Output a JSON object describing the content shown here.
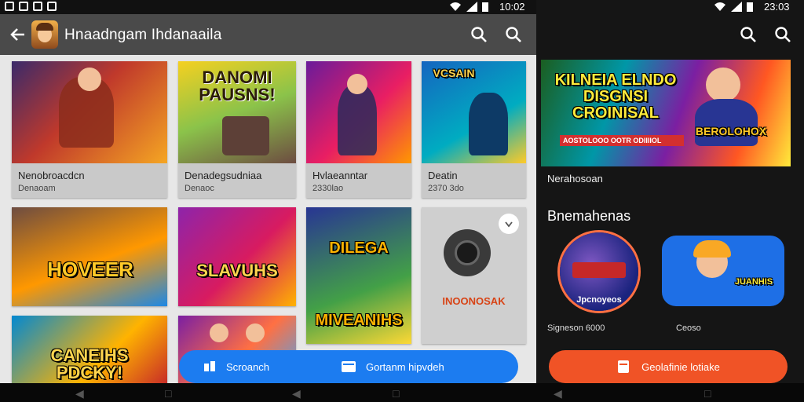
{
  "left": {
    "status_time": "10:02",
    "title": "Hnaadngam Ihdanaaila",
    "back_icon": "arrow-back-icon",
    "search_icons": [
      "search-icon",
      "search-icon"
    ],
    "cards": [
      {
        "title": "Nenobroacdcn",
        "subtitle": "Denaoam",
        "art": "",
        "colors": [
          "#3a2a6a",
          "#f5a623",
          "#c0392b"
        ]
      },
      {
        "title": "Denadegsudniaa",
        "subtitle": "Denaoc",
        "art": "DANOMI PAUSNS!",
        "colors": [
          "#f5d020",
          "#2e7d32",
          "#6d4c41"
        ]
      },
      {
        "title": "Hvlaeanntar",
        "subtitle": "2330lao",
        "art": "",
        "colors": [
          "#6a1b9a",
          "#e91e63",
          "#ff9800"
        ]
      },
      {
        "title": "Deatin",
        "subtitle": "2370 3do",
        "art": "VCSAIN",
        "colors": [
          "#1565c0",
          "#00acc1",
          "#ffca28"
        ]
      },
      {
        "title": "",
        "subtitle": "",
        "art": "HOVEER",
        "colors": [
          "#6d4c41",
          "#ff9800",
          "#1e88e5"
        ]
      },
      {
        "title": "",
        "subtitle": "",
        "art": "SLAVUHS",
        "colors": [
          "#8e24aa",
          "#ffb300",
          "#d81b60"
        ]
      },
      {
        "title": "",
        "subtitle": "",
        "art": "DILEGA MIVEANIHS",
        "colors": [
          "#283593",
          "#fdd835",
          "#43a047"
        ]
      },
      {
        "title": "",
        "subtitle": "",
        "art": "INOONOSAK",
        "colors": [
          "#cfcfcf",
          "#3a3a3a",
          "#d84315"
        ]
      },
      {
        "title": "",
        "subtitle": "",
        "art": "CANEIHS PDCKY!",
        "colors": [
          "#0288d1",
          "#ffb300",
          "#c62828"
        ]
      },
      {
        "title": "",
        "subtitle": "",
        "art": "",
        "colors": [
          "#7b1fa2",
          "#ff7043",
          "#42a5f5"
        ]
      }
    ],
    "fab_left_label": "Scroanch",
    "fab_right_label": "Gortanm hipvdeh"
  },
  "right": {
    "status_time": "23:03",
    "search_icons": [
      "search-icon",
      "search-icon"
    ],
    "banner_text": "KILNEIA ELNDO DISGNSI CROINISAL",
    "banner_sub": "AOSTOLOOO OOTR ODIIIIOL",
    "banner_tag": "BEROLOHOX",
    "banner_caption": "Nerahosoan",
    "section_title": "Bnemahenas",
    "items": [
      {
        "label": "Signeson 6000",
        "badge": "Jpcnoyeos"
      },
      {
        "label": "Ceoso",
        "badge": "JUANHIS"
      }
    ],
    "button_label": "Geolafinie lotiake"
  }
}
